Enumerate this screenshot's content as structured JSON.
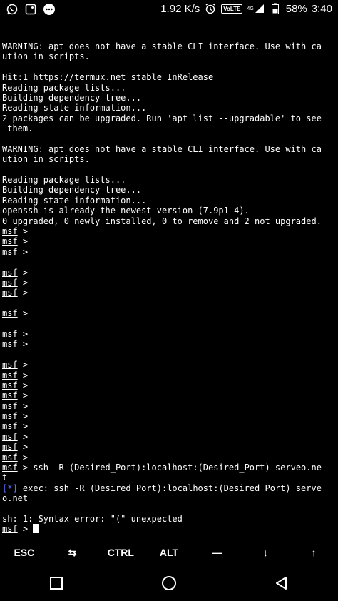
{
  "status_bar": {
    "left_icons": [
      "whatsapp-icon",
      "gallery-icon",
      "chat-bubble-icon"
    ],
    "speed": "1.92 K/s",
    "volte": "VoLTE",
    "network": "4G",
    "battery_pct": "58%",
    "time": "3:40"
  },
  "terminal": {
    "lines": [
      "WARNING: apt does not have a stable CLI interface. Use with ca",
      "ution in scripts.",
      "",
      "Hit:1 https://termux.net stable InRelease",
      "Reading package lists...",
      "Building dependency tree...",
      "Reading state information...",
      "2 packages can be upgraded. Run 'apt list --upgradable' to see",
      " them.",
      "",
      "WARNING: apt does not have a stable CLI interface. Use with ca",
      "ution in scripts.",
      "",
      "Reading package lists...",
      "Building dependency tree...",
      "Reading state information...",
      "openssh is already the newest version (7.9p1-4).",
      "0 upgraded, 0 newly installed, 0 to remove and 2 not upgraded.",
      "msf >",
      "msf >",
      "msf >",
      "",
      "msf >",
      "msf >",
      "msf >",
      "",
      "msf >",
      "",
      "msf >",
      "msf >",
      "",
      "msf >",
      "msf >",
      "msf >",
      "msf >",
      "msf >",
      "msf >",
      "msf >",
      "msf >",
      "msf >",
      "msf >",
      "msf > ssh -R (Desired_Port):localhost:(Desired_Port) serveo.ne",
      "t",
      "[*] exec: ssh -R (Desired_Port):localhost:(Desired_Port) serve",
      "o.net",
      "",
      "sh: 1: Syntax error: \"(\" unexpected",
      "msf > "
    ]
  },
  "extra_keys": [
    "ESC",
    "⇆",
    "CTRL",
    "ALT",
    "—",
    "↓",
    "↑"
  ],
  "nav": [
    "back-icon",
    "home-icon",
    "recents-icon"
  ]
}
